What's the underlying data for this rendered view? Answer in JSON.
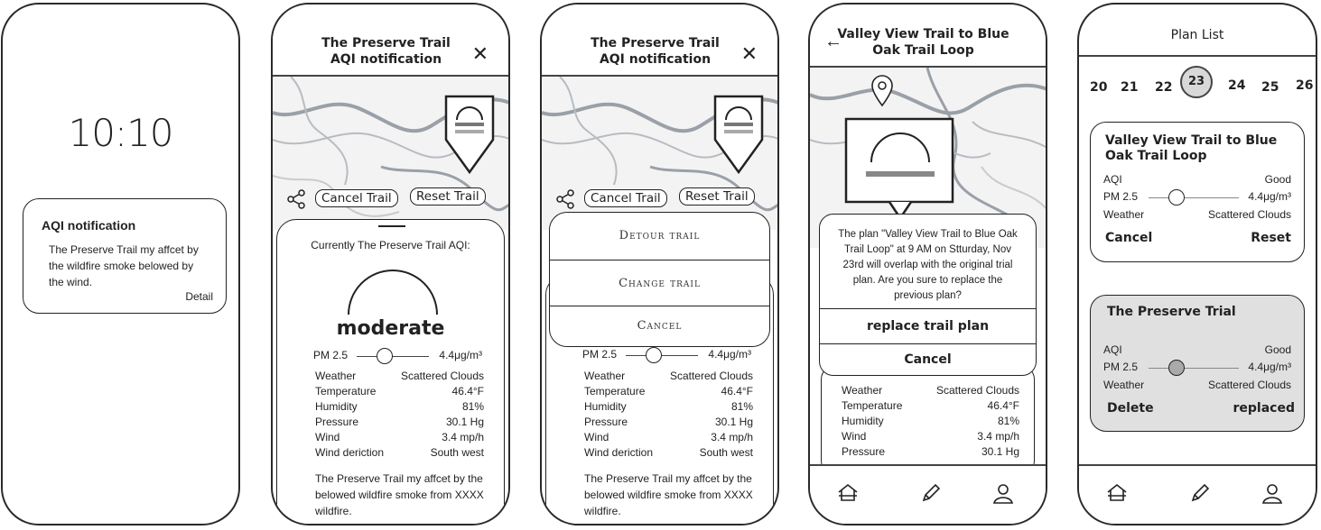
{
  "phone1": {
    "time": "10:10",
    "notification": {
      "title": "AQI notification",
      "body": "The Preserve Trail my affcet by the wildfire smoke belowed by the wind.",
      "detail": "Detail"
    }
  },
  "phone2": {
    "title_line1": "The Preserve Trail",
    "title_line2": "AQI notification",
    "cancel_trail": "Cancel Trail",
    "reset_trail": "Reset Trail",
    "currently": "Currently The Preserve Trail AQI:",
    "aqi_level": "moderate",
    "pm25_label": "PM 2.5",
    "pm25_value": "4.4μg/m³",
    "pm25_fraction": 0.25,
    "rows": [
      {
        "label": "Weather",
        "value": "Scattered Clouds"
      },
      {
        "label": "Temperature",
        "value": "46.4°F"
      },
      {
        "label": "Humidity",
        "value": "81%"
      },
      {
        "label": "Pressure",
        "value": "30.1 Hg"
      },
      {
        "label": "Wind",
        "value": "3.4 mp/h"
      },
      {
        "label": "Wind deriction",
        "value": "South west"
      }
    ],
    "message": "The Preserve Trail my affcet by the belowed wildfire smoke from XXXX wildfire."
  },
  "phone3": {
    "title_line1": "The Preserve Trail",
    "title_line2": "AQI notification",
    "cancel_trail": "Cancel Trail",
    "reset_trail": "Reset Trail",
    "menu": [
      "Detour trail",
      "Change trail",
      "Cancel"
    ],
    "pm25_label": "PM 2.5",
    "pm25_value": "4.4μg/m³",
    "rows": [
      {
        "label": "Weather",
        "value": "Scattered Clouds"
      },
      {
        "label": "Temperature",
        "value": "46.4°F"
      },
      {
        "label": "Humidity",
        "value": "81%"
      },
      {
        "label": "Pressure",
        "value": "30.1 Hg"
      },
      {
        "label": "Wind",
        "value": "3.4 mp/h"
      },
      {
        "label": "Wind deriction",
        "value": "South west"
      }
    ],
    "message": "The Preserve Trail my affcet by the belowed wildfire smoke from XXXX wildfire."
  },
  "phone4": {
    "title_line1": "Valley View Trail to Blue",
    "title_line2": "Oak Trail Loop",
    "dialog_text": "The plan \"Valley View Trail to Blue Oak Trail Loop\" at 9 AM on Stturday, Nov 23rd will overlap with the original trial plan. Are you sure to replace the previous plan?",
    "replace": "replace trail plan",
    "cancel": "Cancel",
    "rows": [
      {
        "label": "Weather",
        "value": "Scattered Clouds"
      },
      {
        "label": "Temperature",
        "value": "46.4°F"
      },
      {
        "label": "Humidity",
        "value": "81%"
      },
      {
        "label": "Wind",
        "value": "3.4 mp/h"
      },
      {
        "label": "Pressure",
        "value": "30.1 Hg"
      }
    ]
  },
  "phone5": {
    "title": "Plan List",
    "dates": [
      "20",
      "21",
      "22",
      "23",
      "24",
      "25",
      "26"
    ],
    "selected_date": "23",
    "plan1": {
      "title": "Valley View Trail to Blue Oak Trail Loop",
      "aqi_label": "AQI",
      "aqi_value": "Good",
      "pm_label": "PM 2.5",
      "pm_value": "4.4μg/m³",
      "weather_label": "Weather",
      "weather_value": "Scattered Clouds",
      "cancel": "Cancel",
      "reset": "Reset"
    },
    "plan2": {
      "title": "The Preserve Trial",
      "aqi_label": "AQI",
      "aqi_value": "Good",
      "pm_label": "PM 2.5",
      "pm_value": "4.4μg/m³",
      "weather_label": "Weather",
      "weather_value": "Scattered Clouds",
      "delete": "Delete",
      "replaced": "replaced"
    }
  },
  "colors": {
    "stroke": "#222222",
    "map_line": "#9aa0a8",
    "selected_card": "#e0e0e0"
  },
  "icons": [
    "close-icon",
    "share-icon",
    "location-pin-icon",
    "back-arrow-icon",
    "home-icon",
    "pencil-icon",
    "user-icon",
    "aqi-gauge-icon"
  ]
}
